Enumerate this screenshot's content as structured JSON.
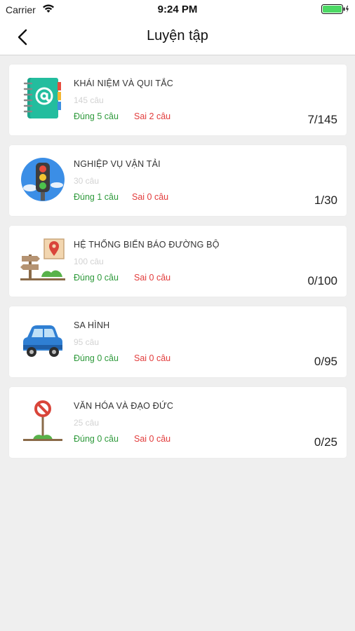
{
  "status_bar": {
    "carrier": "Carrier",
    "time": "9:24 PM"
  },
  "header": {
    "title": "Luyện tập"
  },
  "colors": {
    "correct": "#2f9a3c",
    "wrong": "#e23b3b",
    "muted": "#d2d2d2",
    "battery": "#4cd964"
  },
  "categories": [
    {
      "title": "KHÁI NIỆM VÀ QUI TẮC",
      "count": "145 câu",
      "correct": "Đúng 5  câu",
      "wrong": "Sai 2 câu",
      "progress": "7/145",
      "icon": "address-book-icon"
    },
    {
      "title": "NGHIỆP VỤ VẬN TẢI",
      "count": "30 câu",
      "correct": "Đúng 1  câu",
      "wrong": "Sai 0 câu",
      "progress": "1/30",
      "icon": "traffic-light-icon"
    },
    {
      "title": "HỆ THỐNG BIỂN BÁO ĐƯỜNG BỘ",
      "count": "100 câu",
      "correct": "Đúng 0  câu",
      "wrong": "Sai 0 câu",
      "progress": "0/100",
      "icon": "signpost-map-icon"
    },
    {
      "title": "SA HÌNH",
      "count": "95 câu",
      "correct": "Đúng 0  câu",
      "wrong": "Sai 0 câu",
      "progress": "0/95",
      "icon": "car-icon"
    },
    {
      "title": "VĂN HÓA VÀ ĐẠO ĐỨC",
      "count": "25 câu",
      "correct": "Đúng 0  câu",
      "wrong": "Sai 0 câu",
      "progress": "0/25",
      "icon": "no-entry-sign-icon"
    }
  ]
}
